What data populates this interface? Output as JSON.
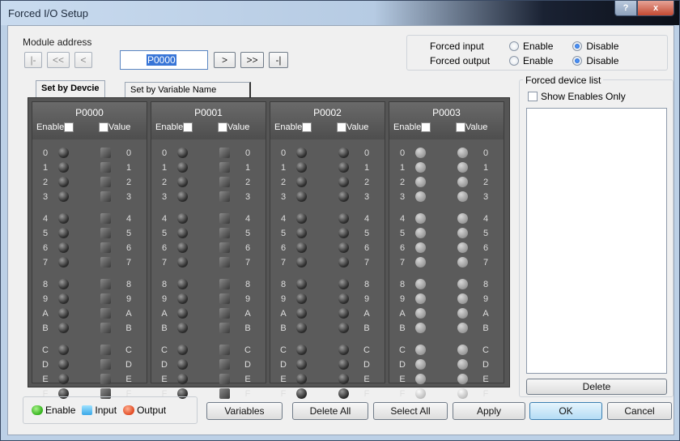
{
  "window": {
    "title": "Forced I/O Setup",
    "help": "?",
    "close": "x"
  },
  "module": {
    "label": "Module address",
    "first": "|-",
    "prev_many": "<<",
    "prev": "<",
    "address": "P0000",
    "next": ">",
    "next_many": ">>",
    "last": "-|"
  },
  "forced": {
    "input_label": "Forced input",
    "output_label": "Forced output",
    "enable": "Enable",
    "disable": "Disable",
    "input_selected": "Disable",
    "output_selected": "Disable"
  },
  "tabs": [
    {
      "label": "Set by Devcie",
      "active": true
    },
    {
      "label": "Set by Variable Name",
      "active": false
    }
  ],
  "bits": [
    "0",
    "1",
    "2",
    "3",
    "4",
    "5",
    "6",
    "7",
    "8",
    "9",
    "A",
    "B",
    "C",
    "D",
    "E",
    "F"
  ],
  "columns": [
    {
      "name": "P0000",
      "enable_label": "Enable",
      "value_label": "Value",
      "value_shape": "square",
      "ghost": false
    },
    {
      "name": "P0001",
      "enable_label": "Enable",
      "value_label": "Value",
      "value_shape": "square",
      "ghost": false
    },
    {
      "name": "P0002",
      "enable_label": "Enable",
      "value_label": "Value",
      "value_shape": "round",
      "ghost": false
    },
    {
      "name": "P0003",
      "enable_label": "Enable",
      "value_label": "Value",
      "value_shape": "round",
      "ghost": true
    }
  ],
  "device_list": {
    "title": "Forced device list",
    "show_enables_only": "Show Enables Only",
    "delete": "Delete"
  },
  "legend": {
    "enable": "Enable",
    "input": "Input",
    "output": "Output"
  },
  "buttons": {
    "variables": "Variables",
    "delete_all": "Delete All",
    "select_all": "Select All",
    "apply": "Apply",
    "ok": "OK",
    "cancel": "Cancel"
  }
}
